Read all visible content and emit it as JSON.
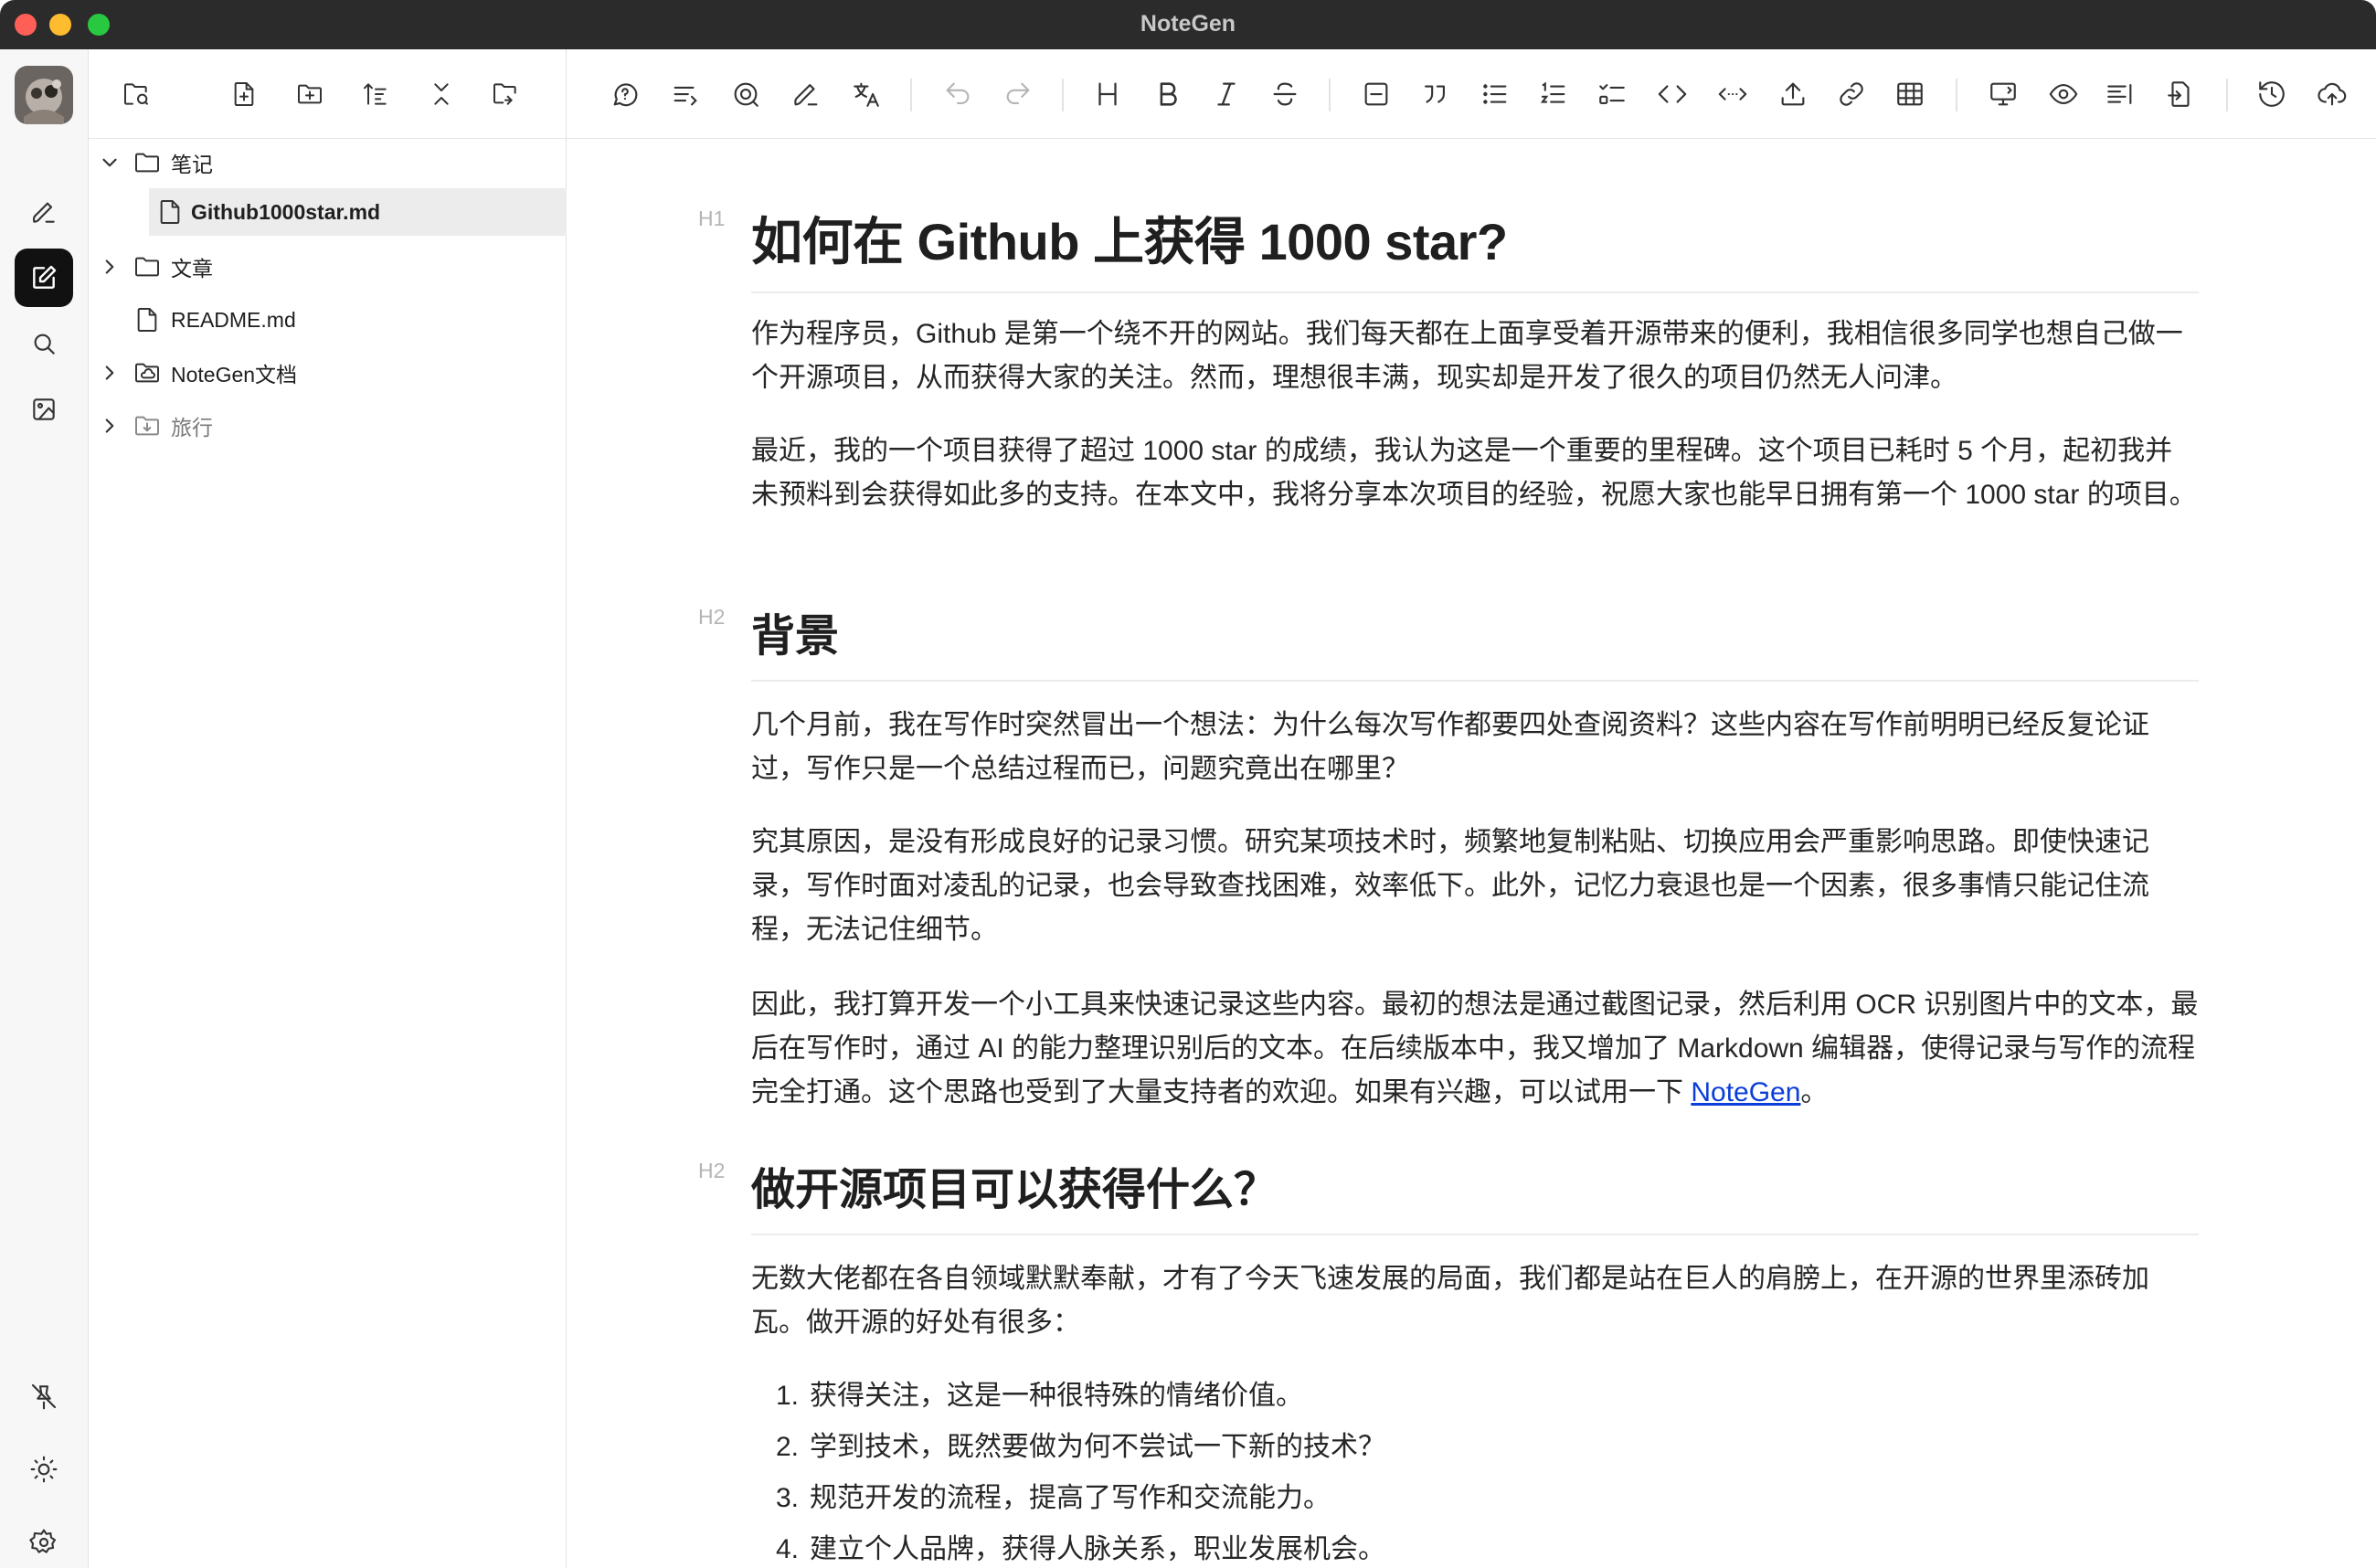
{
  "window": {
    "title": "NoteGen"
  },
  "colors": {
    "accent": "#111111",
    "link": "#0b3ed8",
    "titlebar": "#2b2b2b",
    "selected_row": "#ececec"
  },
  "activity_bar": {
    "items": [
      {
        "name": "record",
        "icon": "pen-icon"
      },
      {
        "name": "write",
        "icon": "edit-icon",
        "active": true
      },
      {
        "name": "search",
        "icon": "search-icon"
      },
      {
        "name": "gallery",
        "icon": "image-icon"
      }
    ],
    "bottom": [
      {
        "name": "unpin",
        "icon": "pin-off-icon"
      },
      {
        "name": "theme",
        "icon": "sun-icon"
      },
      {
        "name": "settings",
        "icon": "gear-icon"
      }
    ]
  },
  "file_panel": {
    "tools": [
      "folder-sync-icon",
      "new-file-icon",
      "new-folder-icon",
      "sort-icon",
      "collapse-icon",
      "folder-search-icon"
    ],
    "tree": [
      {
        "label": "笔记",
        "type": "folder",
        "expanded": true
      },
      {
        "label": "Github1000star.md",
        "type": "file",
        "selected": true
      },
      {
        "label": "文章",
        "type": "folder",
        "expanded": false
      },
      {
        "label": "README.md",
        "type": "file"
      },
      {
        "label": "NoteGen文档",
        "type": "folder-cloud",
        "expanded": false
      },
      {
        "label": "旅行",
        "type": "folder-download",
        "expanded": false
      }
    ]
  },
  "toolbar": {
    "icons": [
      "chat-icon",
      "continue-icon",
      "polish-icon",
      "eraser-icon",
      "translate-icon",
      "undo-icon",
      "redo-icon",
      "heading-icon",
      "bold-icon",
      "italic-icon",
      "strikethrough-icon",
      "hr-icon",
      "quote-icon",
      "unordered-list-icon",
      "ordered-list-icon",
      "checklist-icon",
      "code-icon",
      "inline-code-icon",
      "upload-icon",
      "link-icon",
      "table-icon",
      "screen-icon",
      "preview-icon",
      "outline-icon",
      "export-icon",
      "history-icon",
      "cloud-upload-icon"
    ]
  },
  "document": {
    "h1": {
      "marker": "H1",
      "text": "如何在 Github 上获得 1000 star?"
    },
    "p1": "作为程序员，Github 是第一个绕不开的网站。我们每天都在上面享受着开源带来的便利，我相信很多同学也想自己做一个开源项目，从而获得大家的关注。然而，理想很丰满，现实却是开发了很久的项目仍然无人问津。",
    "p2": "最近，我的一个项目获得了超过 1000 star 的成绩，我认为这是一个重要的里程碑。这个项目已耗时 5 个月，起初我并未预料到会获得如此多的支持。在本文中，我将分享本次项目的经验，祝愿大家也能早日拥有第一个 1000 star 的项目。",
    "h2a": {
      "marker": "H2",
      "text": "背景"
    },
    "p3": "几个月前，我在写作时突然冒出一个想法：为什么每次写作都要四处查阅资料？这些内容在写作前明明已经反复论证过，写作只是一个总结过程而已，问题究竟出在哪里？",
    "p4": "究其原因，是没有形成良好的记录习惯。研究某项技术时，频繁地复制粘贴、切换应用会严重影响思路。即使快速记录，写作时面对凌乱的记录，也会导致查找困难，效率低下。此外，记忆力衰退也是一个因素，很多事情只能记住流程，无法记住细节。",
    "p5_before": "因此，我打算开发一个小工具来快速记录这些内容。最初的想法是通过截图记录，然后利用 OCR 识别图片中的文本，最后在写作时，通过 AI 的能力整理识别后的文本。在后续版本中，我又增加了 Markdown 编辑器，使得记录与写作的流程完全打通。这个思路也受到了大量支持者的欢迎。如果有兴趣，可以试用一下 ",
    "p5_link": "NoteGen",
    "p5_after": "。",
    "h2b": {
      "marker": "H2",
      "text": "做开源项目可以获得什么？"
    },
    "p6": "无数大佬都在各自领域默默奉献，才有了今天飞速发展的局面，我们都是站在巨人的肩膀上，在开源的世界里添砖加瓦。做开源的好处有很多：",
    "list": [
      {
        "num": "1.",
        "text": "获得关注，这是一种很特殊的情绪价值。"
      },
      {
        "num": "2.",
        "text": "学到技术，既然要做为何不尝试一下新的技术？"
      },
      {
        "num": "3.",
        "text": "规范开发的流程，提高了写作和交流能力。"
      },
      {
        "num": "4.",
        "text": "建立个人品牌，获得人脉关系，职业发展机会。"
      }
    ]
  }
}
